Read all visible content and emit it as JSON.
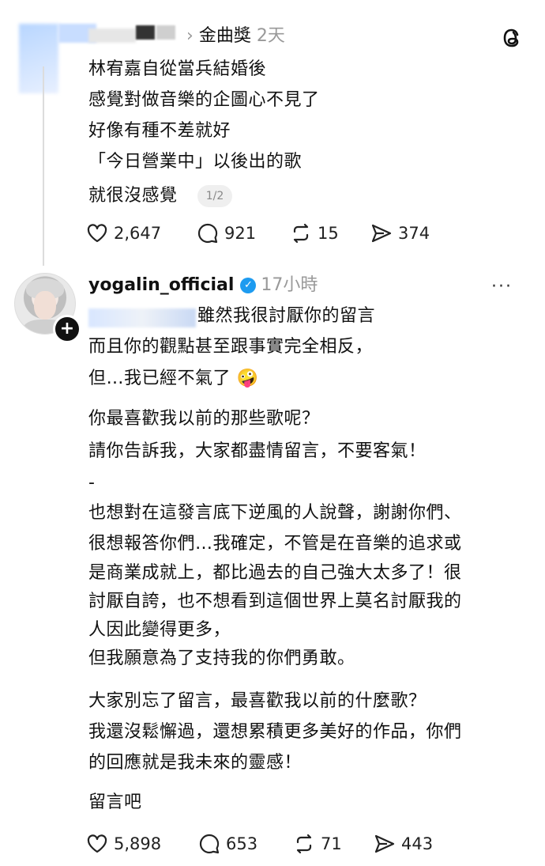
{
  "first_post": {
    "breadcrumb_sep": "›",
    "topic": "金曲獎",
    "time": "2天",
    "lines": [
      "林宥嘉自從當兵結婚後",
      "感覺對做音樂的企圖心不見了",
      "好像有種不差就好",
      "「今日營業中」以後出的歌",
      "就很沒感覺"
    ],
    "pager": "1/2",
    "likes": "2,647",
    "replies": "921",
    "reposts": "15",
    "shares": "374"
  },
  "second_post": {
    "username": "yogalin_official",
    "verified_mark": "✓",
    "time": "17小時",
    "more": "···",
    "lines": [
      "雖然我很討厭你的留言",
      "而且你的觀點甚至跟事實完全相反，",
      "但…我已經不氣了",
      "你最喜歡我以前的那些歌呢？",
      "請你告訴我，大家都盡情留言，不要客氣！",
      "-",
      "也想對在這發言底下逆風的人說聲，謝謝你們、",
      "很想報答你們…我確定，不管是在音樂的追求或",
      "是商業成就上，都比過去的自己強大太多了！很",
      "討厭自誇，也不想看到這個世界上莫名討厭我的",
      "人因此變得更多，",
      "但我願意為了支持我的你們勇敢。",
      "大家別忘了留言，最喜歡我以前的什麼歌？",
      "我還沒鬆懈過，還想累積更多美好的作品，你們",
      "的回應就是我未來的靈感！",
      "留言吧"
    ],
    "emoji": "🤪",
    "likes": "5,898",
    "replies": "653",
    "reposts": "71",
    "shares": "443"
  },
  "icons": [
    "threads-logo-icon",
    "heart-icon",
    "comment-icon",
    "repost-icon",
    "share-icon",
    "verified-icon",
    "more-icon",
    "follow-plus-icon"
  ]
}
